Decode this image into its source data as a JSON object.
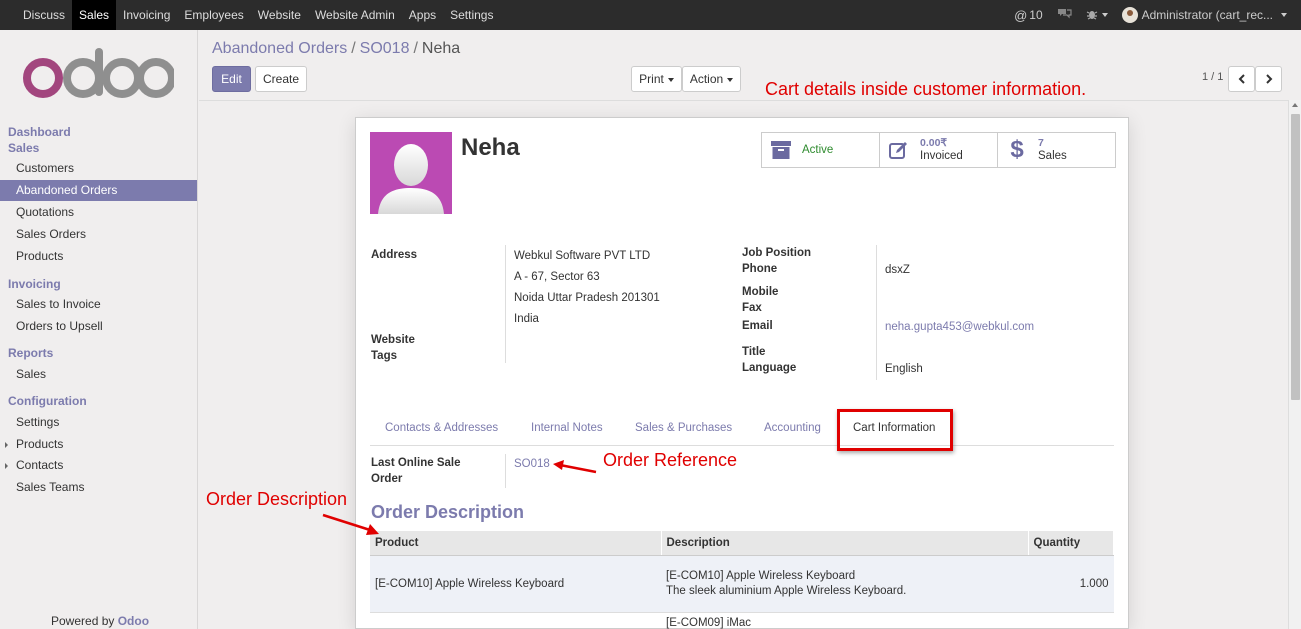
{
  "topbar": {
    "menu": [
      "Discuss",
      "Sales",
      "Invoicing",
      "Employees",
      "Website",
      "Website Admin",
      "Apps",
      "Settings"
    ],
    "active_index": 1,
    "mentions": "10",
    "user": "Administrator (cart_rec..."
  },
  "sidebar": {
    "sections": [
      {
        "title": "Dashboard"
      },
      {
        "title": "Sales",
        "items": [
          "Customers",
          "Abandoned Orders",
          "Quotations",
          "Sales Orders",
          "Products"
        ]
      },
      {
        "title": "Invoicing",
        "items": [
          "Sales to Invoice",
          "Orders to Upsell"
        ]
      },
      {
        "title": "Reports",
        "items": [
          "Sales"
        ]
      },
      {
        "title": "Configuration",
        "items": [
          "Settings",
          "Products",
          "Contacts",
          "Sales Teams"
        ]
      }
    ],
    "active_item": "Abandoned Orders",
    "powered_prefix": "Powered by ",
    "powered_brand": "Odoo"
  },
  "breadcrumb": {
    "items": [
      "Abandoned Orders",
      "SO018"
    ],
    "current": "Neha"
  },
  "buttons": {
    "edit": "Edit",
    "create": "Create",
    "print": "Print",
    "action": "Action"
  },
  "pager": {
    "text": "1 / 1"
  },
  "annotations": {
    "top": "Cart details inside customer information.",
    "order_reference": "Order Reference",
    "order_description": "Order Description"
  },
  "partner": {
    "name": "Neha",
    "stats": {
      "active": "Active",
      "invoiced_amount": "0.00₹",
      "invoiced_label": "Invoiced",
      "sales_count": "7",
      "sales_label": "Sales"
    },
    "address_label": "Address",
    "address_lines": [
      "Webkul Software PVT LTD",
      "A - 67, Sector 63",
      "Noida Uttar Pradesh 201301",
      "India"
    ],
    "website_label": "Website",
    "tags_label": "Tags",
    "job_position_label": "Job Position",
    "phone_label": "Phone",
    "phone_value": "dsxZ",
    "mobile_label": "Mobile",
    "fax_label": "Fax",
    "email_label": "Email",
    "email_value": "neha.gupta453@webkul.com",
    "title_label": "Title",
    "language_label": "Language",
    "language_value": "English"
  },
  "tabs": [
    "Contacts & Addresses",
    "Internal Notes",
    "Sales & Purchases",
    "Accounting",
    "Cart Information"
  ],
  "active_tab": "Cart Information",
  "cart": {
    "last_order_label_1": "Last Online Sale",
    "last_order_label_2": "Order",
    "last_order_value": "SO018",
    "section_title": "Order Description",
    "columns": [
      "Product",
      "Description",
      "Quantity"
    ],
    "rows": [
      {
        "product": "[E-COM10] Apple Wireless Keyboard",
        "description_1": "[E-COM10] Apple Wireless Keyboard",
        "description_2": "The sleek aluminium Apple Wireless Keyboard.",
        "quantity": "1.000"
      },
      {
        "product": "",
        "description_1": "[E-COM09] iMac",
        "description_2": "",
        "quantity": ""
      }
    ]
  },
  "colors": {
    "brand": "#7c7bad",
    "annotation": "#e00000",
    "avatar_bg": "#bb4ab3",
    "active_green": "#2e8b2e"
  }
}
